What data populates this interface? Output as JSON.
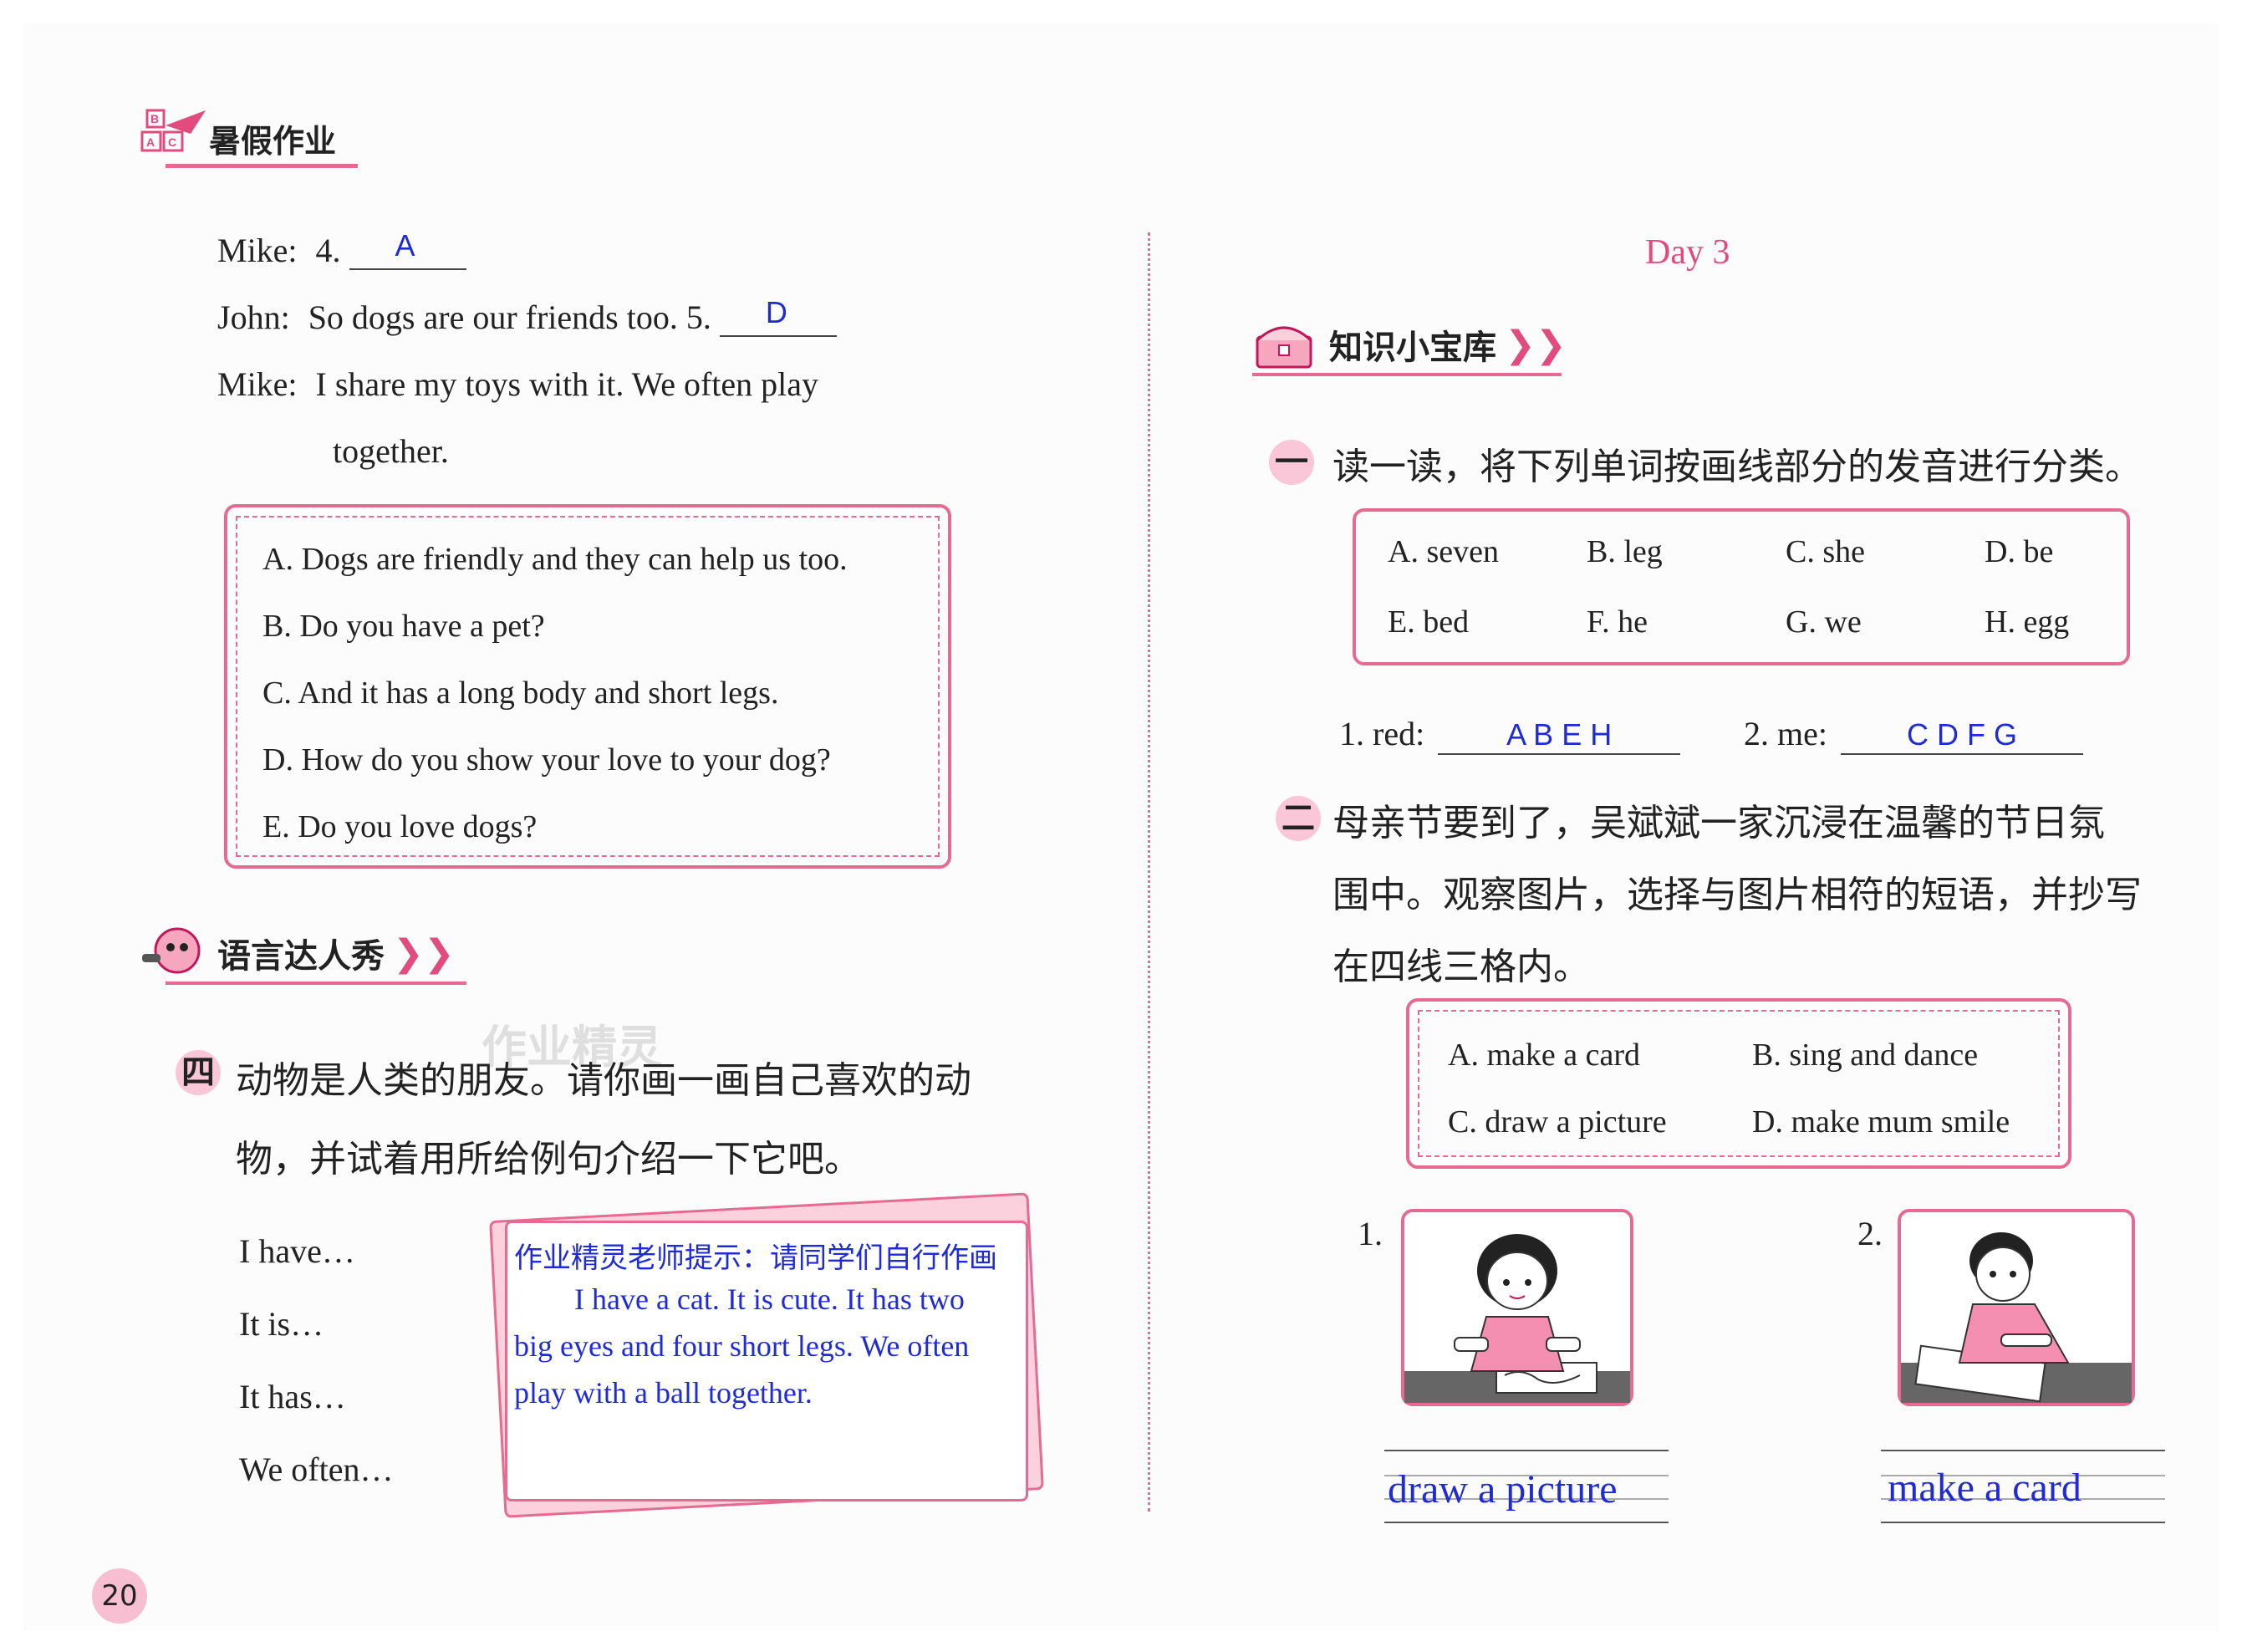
{
  "header": {
    "title": "暑假作业",
    "logo_letters": "ABC"
  },
  "left": {
    "dialogue": [
      {
        "speaker": "Mike:",
        "text": "4.",
        "answer": "A",
        "blank": true
      },
      {
        "speaker": "John:",
        "text": "So dogs are our friends too.  5.",
        "answer": "D",
        "blank": true
      },
      {
        "speaker": "Mike:",
        "text": "I share my toys with it.  We often play",
        "continuation": "together."
      }
    ],
    "options": [
      "A. Dogs are friendly and they can help us too.",
      "B. Do you have a pet?",
      "C. And it has a long body and short legs.",
      "D. How do you show your love to your dog?",
      "E. Do you love dogs?"
    ],
    "section_title": "语言达人秀",
    "q4": {
      "num": "四",
      "text1": "动物是人类的朋友。请你画一画自己喜欢的动",
      "text2": "物，并试着用所给例句介绍一下它吧。"
    },
    "prompts": [
      "I have…",
      "It is…",
      "It has…",
      "We often…"
    ],
    "note": {
      "hint": "作业精灵老师提示：请同学们自行作画",
      "line1": "I have a cat. It is cute. It has two",
      "line2": "big eyes and four short legs. We often",
      "line3": "play with a ball together."
    },
    "watermark": "作业精灵",
    "page_number": "20"
  },
  "right": {
    "day": "Day 3",
    "section_title": "知识小宝库",
    "q1": {
      "num": "一",
      "text": "读一读，将下列单词按画线部分的发音进行分类。",
      "words": [
        "A. seven",
        "B. leg",
        "C. she",
        "D. be",
        "E. bed",
        "F. he",
        "G. we",
        "H. egg"
      ],
      "item1_label": "1. red:",
      "item1_answer": "A B E H",
      "item2_label": "2. me:",
      "item2_answer": "C D F G"
    },
    "q2": {
      "num": "二",
      "text1": "母亲节要到了，吴斌斌一家沉浸在温馨的节日氛",
      "text2": "围中。观察图片，选择与图片相符的短语，并抄写",
      "text3": "在四线三格内。",
      "phrases": [
        "A. make a card",
        "B. sing and dance",
        "C. draw a picture",
        "D. make mum smile"
      ],
      "pic1_num": "1.",
      "pic1_answer": "draw a picture",
      "pic2_num": "2.",
      "pic2_answer": "make a card"
    }
  },
  "colors": {
    "pink": "#e56b93",
    "answer_blue": "#1f2bd6"
  }
}
